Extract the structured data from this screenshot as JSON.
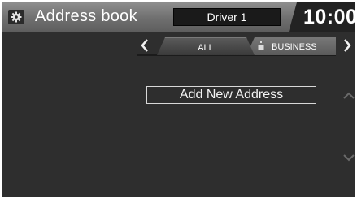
{
  "header": {
    "title": "Address book",
    "driver": "Driver 1",
    "time": "10:00",
    "home_icon": "home-gear-icon"
  },
  "tabs": {
    "items": [
      {
        "label": "ALL",
        "selected": true
      },
      {
        "label": "BUSINESS",
        "selected": false,
        "icon": "briefcase-icon"
      }
    ],
    "prev_icon": "chevron-left-icon",
    "next_icon": "chevron-right-icon"
  },
  "list": {
    "add_label": "Add New Address"
  },
  "scroll": {
    "up_icon": "scroll-up-icon",
    "down_icon": "scroll-down-icon"
  },
  "colors": {
    "background": "#2e2e2e",
    "header": "#7a7a7a",
    "text": "#ffffff"
  }
}
